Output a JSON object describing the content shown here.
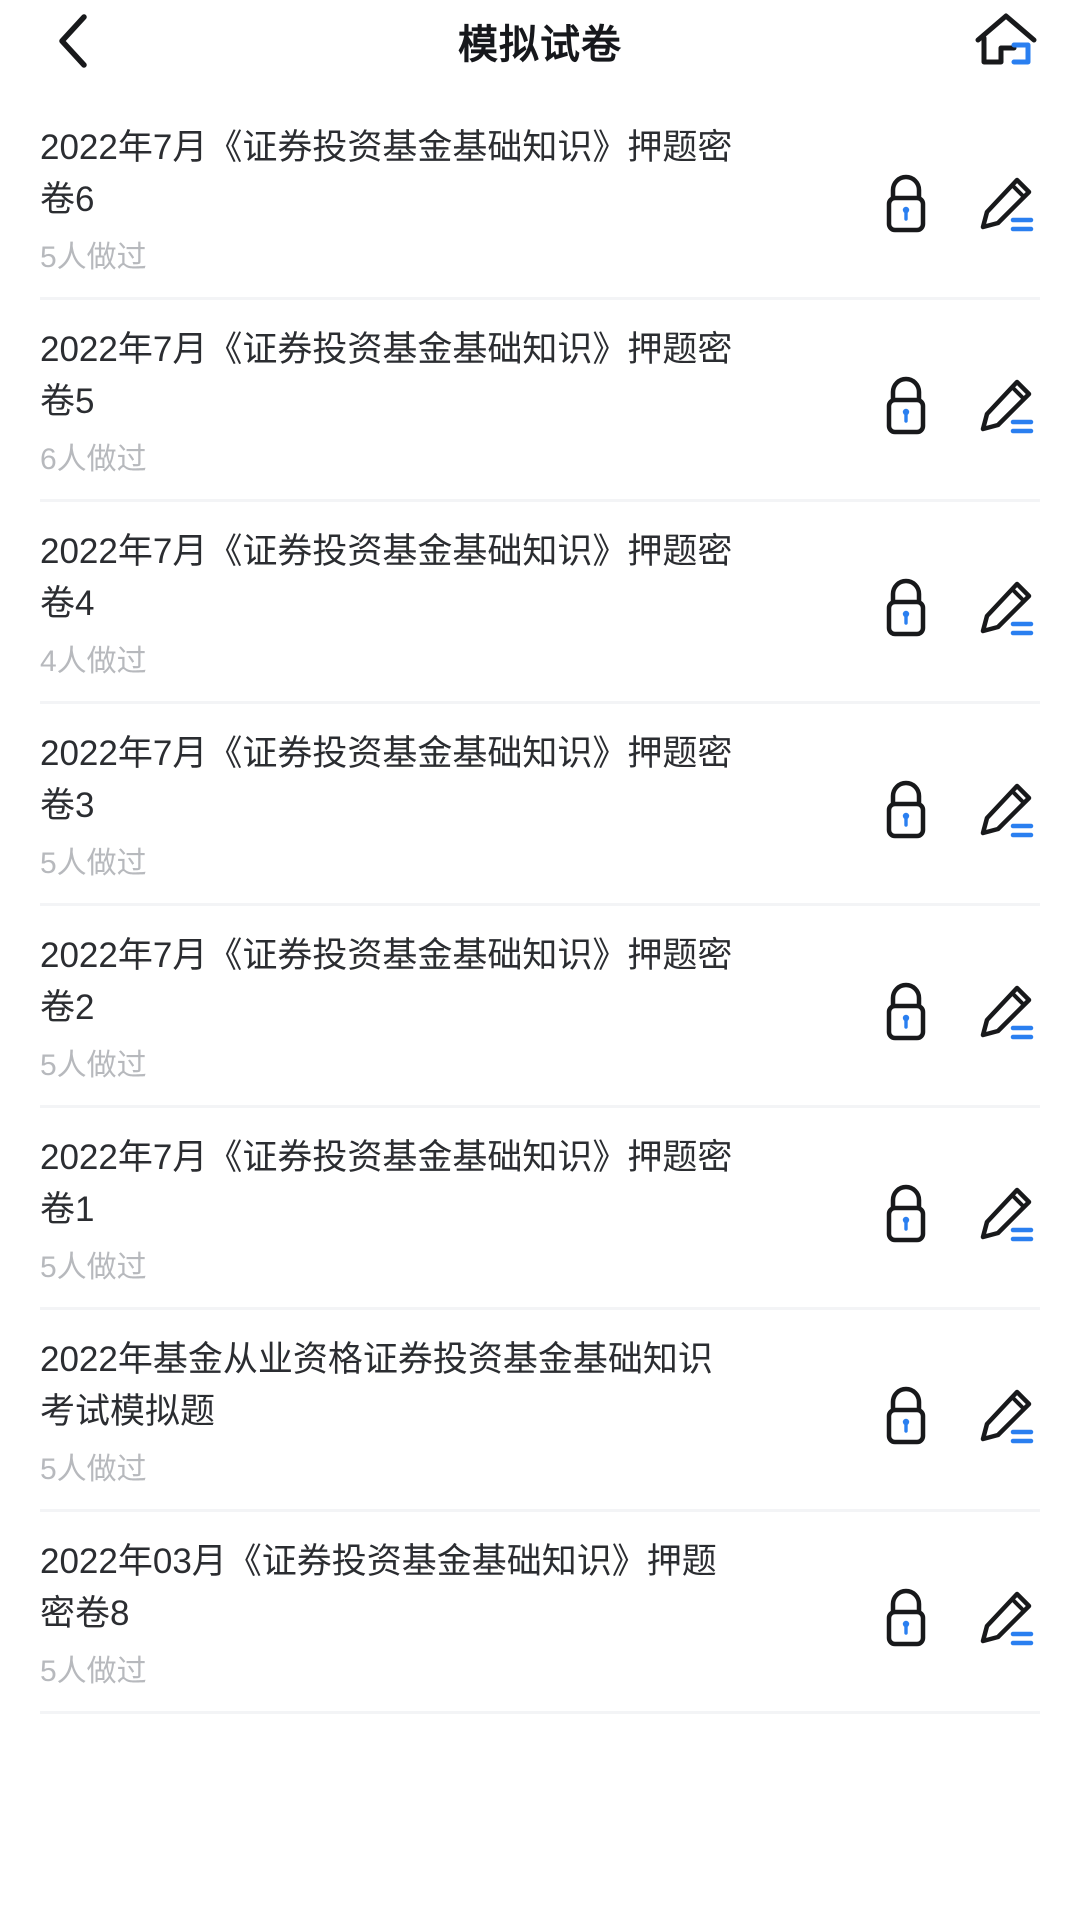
{
  "header": {
    "title": "模拟试卷",
    "back_icon": "chevron-left-icon",
    "home_icon": "home-icon"
  },
  "colors": {
    "accent": "#2a7ff0",
    "title_text": "#2b2d31",
    "sub_text": "#b7b9bd",
    "divider": "#f3f4f6",
    "background": "#ffffff",
    "icon_stroke": "#18191b"
  },
  "actions": {
    "lock_icon": "lock-icon",
    "edit_icon": "pencil-icon"
  },
  "list": {
    "items": [
      {
        "title": "2022年7月《证券投资基金基础知识》押题密卷6",
        "subtitle": "5人做过"
      },
      {
        "title": "2022年7月《证券投资基金基础知识》押题密卷5",
        "subtitle": "6人做过"
      },
      {
        "title": "2022年7月《证券投资基金基础知识》押题密卷4",
        "subtitle": "4人做过"
      },
      {
        "title": "2022年7月《证券投资基金基础知识》押题密卷3",
        "subtitle": "5人做过"
      },
      {
        "title": "2022年7月《证券投资基金基础知识》押题密卷2",
        "subtitle": "5人做过"
      },
      {
        "title": "2022年7月《证券投资基金基础知识》押题密卷1",
        "subtitle": "5人做过"
      },
      {
        "title": "2022年基金从业资格证券投资基金基础知识考试模拟题",
        "subtitle": "5人做过"
      },
      {
        "title": "2022年03月《证券投资基金基础知识》押题密卷8",
        "subtitle": "5人做过"
      }
    ]
  }
}
